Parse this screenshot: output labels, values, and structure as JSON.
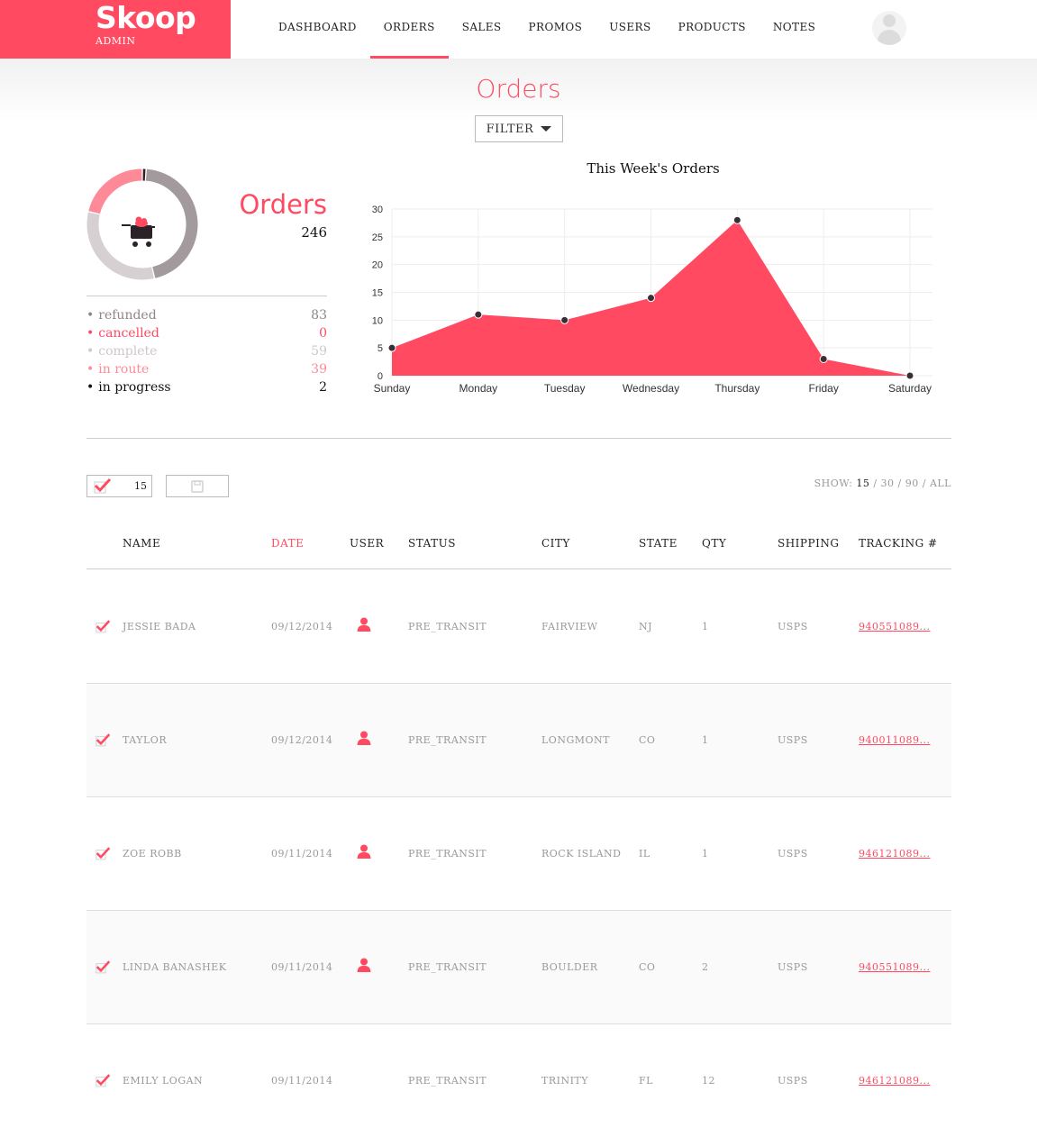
{
  "brand": {
    "name": "Skoop",
    "sub": "ADMIN",
    "color": "#ff4a62"
  },
  "nav": [
    {
      "label": "DASHBOARD"
    },
    {
      "label": "ORDERS",
      "active": true
    },
    {
      "label": "SALES"
    },
    {
      "label": "PROMOS"
    },
    {
      "label": "USERS"
    },
    {
      "label": "PRODUCTS"
    },
    {
      "label": "NOTES"
    }
  ],
  "page": {
    "title": "Orders",
    "filter_label": "FILTER"
  },
  "stats": {
    "title": "Orders",
    "total": "246",
    "legend": [
      {
        "label": "refunded",
        "value": "83",
        "color": "#a39a9e"
      },
      {
        "label": "cancelled",
        "value": "0",
        "color": "#ff4a62"
      },
      {
        "label": "complete",
        "value": "59",
        "color": "#d6d0d3"
      },
      {
        "label": "in route",
        "value": "39",
        "color": "#ff8a97"
      },
      {
        "label": "in progress",
        "value": "2",
        "color": "#2b2228"
      }
    ]
  },
  "chart_data": {
    "type": "area",
    "title": "This Week's Orders",
    "categories": [
      "Sunday",
      "Monday",
      "Tuesday",
      "Wednesday",
      "Thursday",
      "Friday",
      "Saturday"
    ],
    "values": [
      5,
      11,
      10,
      14,
      28,
      3,
      0
    ],
    "ylim": [
      0,
      30
    ],
    "yticks": [
      0,
      5,
      10,
      15,
      20,
      25,
      30
    ],
    "grid": true,
    "fill_color": "#ff4a62"
  },
  "toolbar": {
    "selected_count": "15",
    "show_label": "SHOW:",
    "show_options": [
      "15",
      "30",
      "90",
      "ALL"
    ],
    "show_current": "15"
  },
  "table": {
    "columns": [
      "NAME",
      "DATE",
      "USER",
      "STATUS",
      "CITY",
      "STATE",
      "QTY",
      "SHIPPING",
      "TRACKING #"
    ],
    "sorted_column": "DATE",
    "rows": [
      {
        "name": "JESSIE BADA",
        "date": "09/12/2014",
        "has_user": true,
        "status": "PRE_TRANSIT",
        "city": "FAIRVIEW",
        "state": "NJ",
        "qty": "1",
        "shipping": "USPS",
        "tracking": "940551089..."
      },
      {
        "name": "TAYLOR",
        "date": "09/12/2014",
        "has_user": true,
        "status": "PRE_TRANSIT",
        "city": "LONGMONT",
        "state": "CO",
        "qty": "1",
        "shipping": "USPS",
        "tracking": "940011089..."
      },
      {
        "name": "ZOE ROBB",
        "date": "09/11/2014",
        "has_user": true,
        "status": "PRE_TRANSIT",
        "city": "ROCK ISLAND",
        "state": "IL",
        "qty": "1",
        "shipping": "USPS",
        "tracking": "946121089..."
      },
      {
        "name": "LINDA BANASHEK",
        "date": "09/11/2014",
        "has_user": true,
        "status": "PRE_TRANSIT",
        "city": "BOULDER",
        "state": "CO",
        "qty": "2",
        "shipping": "USPS",
        "tracking": "940551089..."
      },
      {
        "name": "EMILY LOGAN",
        "date": "09/11/2014",
        "has_user": false,
        "status": "PRE_TRANSIT",
        "city": "TRINITY",
        "state": "FL",
        "qty": "12",
        "shipping": "USPS",
        "tracking": "946121089..."
      }
    ]
  }
}
